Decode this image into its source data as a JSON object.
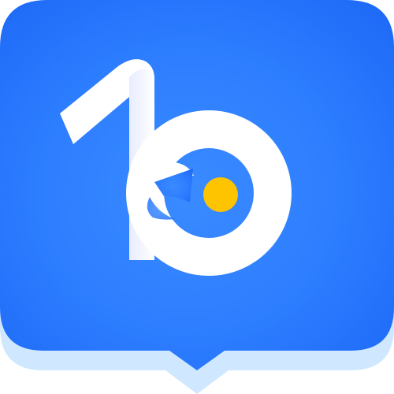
{
  "icon": {
    "name": "app-logo-icon",
    "shape": "rounded-square speech bubble with stylized numeral 1 and letter b",
    "colors": {
      "tile_light_edge": "#cfe8ff",
      "tile_top": "#2b86ff",
      "tile_mid": "#1f77ff",
      "tile_bottom": "#2d6ff0",
      "glyph_white": "#ffffff",
      "glyph_shade": "#d9e1ff",
      "accent_dot": "#ffc400"
    }
  }
}
